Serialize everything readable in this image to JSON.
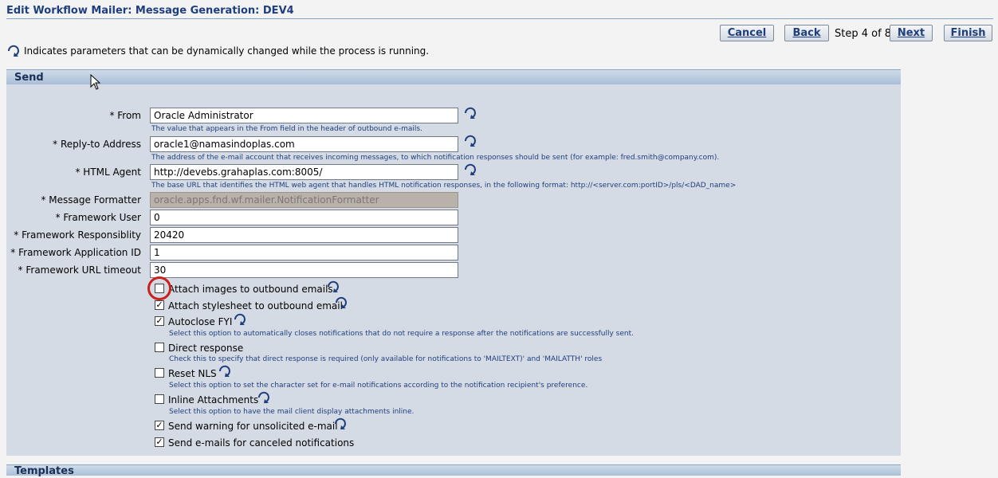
{
  "header": {
    "title": "Edit Workflow Mailer: Message Generation: DEV4",
    "cancel_label": "Cancel",
    "back_label": "Back",
    "step_text": "Step 4 of 8",
    "next_label": "Next",
    "finish_label": "Finish"
  },
  "legend_text": "Indicates parameters that can be dynamically changed while the process is running.",
  "section_send": {
    "title": "Send",
    "fields": {
      "from": {
        "label": "* From",
        "value": "Oracle Administrator",
        "hint": "The value that appears in the From field in the header of outbound e-mails."
      },
      "reply_to": {
        "label": "* Reply-to Address",
        "value": "oracle1@namasindoplas.com",
        "hint": "The address of the e-mail account that receives incoming messages, to which notification responses should be sent (for example: fred.smith@company.com)."
      },
      "html_agent": {
        "label": "* HTML Agent",
        "value": "http://devebs.grahaplas.com:8005/",
        "hint": "The base URL that identifies the HTML web agent that handles HTML notification responses, in the following format: http://<server.com:portID>/pls/<DAD_name>"
      },
      "message_formatter": {
        "label": "* Message Formatter",
        "value": "oracle.apps.fnd.wf.mailer.NotificationFormatter"
      },
      "framework_user": {
        "label": "* Framework User",
        "value": "0"
      },
      "framework_responsibility": {
        "label": "* Framework Responsiblity",
        "value": "20420"
      },
      "framework_application_id": {
        "label": "* Framework Application ID",
        "value": "1"
      },
      "framework_url_timeout": {
        "label": "* Framework URL timeout",
        "value": "30"
      }
    },
    "options": {
      "attach_images": {
        "label": "Attach images to outbound emails",
        "checked": false
      },
      "attach_stylesheet": {
        "label": "Attach stylesheet to outbound email",
        "checked": true
      },
      "autoclose_fyi": {
        "label": "Autoclose FYI",
        "checked": true,
        "hint": "Select this option to automatically closes notifications that do not require a response after the notifications are successfully sent."
      },
      "direct_response": {
        "label": "Direct response",
        "checked": false,
        "hint": "Check this to specify that direct response is required (only available for notifications to 'MAILTEXT)' and 'MAILATTH' roles"
      },
      "reset_nls": {
        "label": "Reset NLS",
        "checked": false,
        "hint": "Select this option to set the character set for e-mail notifications according to the notification recipient's preference."
      },
      "inline_attachments": {
        "label": "Inline Attachments",
        "checked": false,
        "hint": "Select this option to have the mail client display attachments inline."
      },
      "send_warning": {
        "label": "Send warning for unsolicited e-mail",
        "checked": true
      },
      "send_canceled": {
        "label": "Send e-mails for canceled notifications",
        "checked": true
      }
    }
  },
  "section_templates": {
    "title": "Templates"
  },
  "colors": {
    "title_blue": "#1f3e7e",
    "section_header": "#a9bfd8",
    "section_body": "#d5dbe4",
    "highlight_red": "#c9211b"
  }
}
